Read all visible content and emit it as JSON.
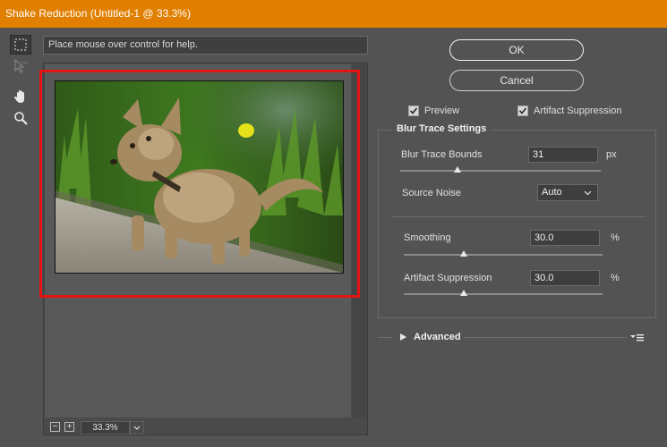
{
  "window": {
    "title": "Shake Reduction (Untitled-1 @ 33.3%)"
  },
  "toolbar": {
    "tools": [
      {
        "name": "blur-trace-tool-icon",
        "active": true
      },
      {
        "name": "blur-estimation-arrow-icon",
        "active": false
      },
      {
        "name": "hand-icon",
        "active": false
      },
      {
        "name": "zoom-icon",
        "active": false
      }
    ]
  },
  "help": {
    "text": "Place mouse over control for help."
  },
  "zoom": {
    "value": "33.3%",
    "minus": "−",
    "plus": "+"
  },
  "buttons": {
    "ok": "OK",
    "cancel": "Cancel"
  },
  "options": {
    "preview": {
      "label": "Preview",
      "checked": true
    },
    "artifact_suppression": {
      "label": "Artifact Suppression",
      "checked": true
    }
  },
  "blur_trace": {
    "title": "Blur Trace Settings",
    "bounds": {
      "label": "Blur Trace Bounds",
      "value": "31",
      "unit": "px",
      "slider_fraction": 0.29
    },
    "source_noise": {
      "label": "Source Noise",
      "value": "Auto"
    },
    "smoothing": {
      "label": "Smoothing",
      "value": "30.0",
      "unit": "%",
      "slider_fraction": 0.3
    },
    "artifact_suppression": {
      "label": "Artifact Suppression",
      "value": "30.0",
      "unit": "%",
      "slider_fraction": 0.3
    }
  },
  "advanced": {
    "label": "Advanced"
  },
  "colors": {
    "title_bar": "#e07f00",
    "highlight_frame": "#e31414",
    "background": "#535353"
  }
}
